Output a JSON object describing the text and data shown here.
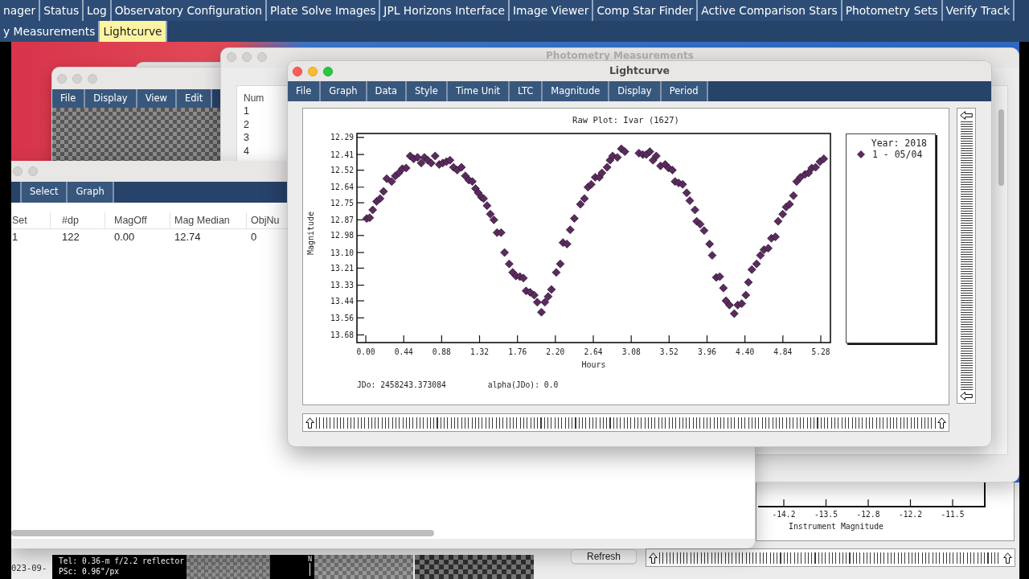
{
  "top_tabs": [
    [
      {
        "label": "nager",
        "selected": false
      },
      {
        "label": "Status",
        "selected": false
      },
      {
        "label": "Log",
        "selected": false
      },
      {
        "label": "Observatory Configuration",
        "selected": false
      },
      {
        "label": "Plate Solve Images",
        "selected": false
      },
      {
        "label": "JPL Horizons Interface",
        "selected": false
      },
      {
        "label": "Image Viewer",
        "selected": false
      },
      {
        "label": "Comp Star Finder",
        "selected": false
      },
      {
        "label": "Active Comparison Stars",
        "selected": false
      },
      {
        "label": "Photometry Sets",
        "selected": false
      },
      {
        "label": "Verify Track",
        "selected": false
      }
    ],
    [
      {
        "label": "y Measurements",
        "selected": false
      },
      {
        "label": "Lightcurve",
        "selected": true
      }
    ]
  ],
  "image_strip": {
    "date": "023-09-",
    "info": [
      "Tel: 0.36-m f/2.2 reflector",
      "PSc: 0.96\"/px"
    ],
    "compass": "N"
  },
  "instrument_window": {
    "button": "Refresh",
    "axis": {
      "ticks": [
        "-14.2",
        "-13.5",
        "-12.8",
        "-12.2",
        "-11.5"
      ],
      "label": "Instrument Magnitude"
    }
  },
  "image_window": {
    "active": false,
    "menu": [
      "File",
      "Display",
      "View",
      "Edit"
    ]
  },
  "photometry_window": {
    "active": false,
    "title": "Photometry Measurements",
    "table": {
      "columns": [
        "Num"
      ],
      "rows": [
        [
          "1"
        ],
        [
          "2"
        ],
        [
          "3"
        ],
        [
          "4"
        ]
      ]
    }
  },
  "sets_window": {
    "active": false,
    "menu": [
      "Select",
      "Graph"
    ],
    "table": {
      "columns": [
        "Set",
        "#dp",
        "MagOff",
        "Mag Median",
        "ObjNu"
      ],
      "rows": [
        [
          "1",
          "122",
          "0.00",
          "12.74",
          "0"
        ]
      ]
    }
  },
  "lightcurve_window": {
    "active": true,
    "title": "Lightcurve",
    "menu": [
      "File",
      "Graph",
      "Data",
      "Style",
      "Time Unit",
      "LTC",
      "Magnitude",
      "Display",
      "Period"
    ],
    "plot": {
      "legend_title": "Year: 2018",
      "jdo": "JDo: 2458243.373084",
      "alpha": "alpha(JDo): 0.0",
      "chart_data": {
        "type": "scatter",
        "title": "Raw Plot: Ivar (1627)",
        "xlabel": "Hours",
        "ylabel": "Magnitude",
        "x": [
          0.01,
          0.045,
          0.08,
          0.125,
          0.165,
          0.206,
          0.243,
          0.3,
          0.343,
          0.384,
          0.424,
          0.468,
          0.515,
          0.555,
          0.6,
          0.643,
          0.68,
          0.718,
          0.758,
          0.805,
          0.852,
          0.893,
          0.936,
          0.977,
          1.018,
          1.061,
          1.11,
          1.155,
          1.196,
          1.236,
          1.273,
          1.305,
          1.342,
          1.367,
          1.407,
          1.445,
          1.486,
          1.523,
          1.57,
          1.61,
          1.664,
          1.704,
          1.742,
          1.788,
          1.829,
          1.86,
          1.907,
          1.954,
          1.99,
          2.038,
          2.078,
          2.116,
          2.154,
          2.21,
          2.257,
          2.288,
          2.335,
          2.372,
          2.42,
          2.49,
          2.537,
          2.578,
          2.616,
          2.662,
          2.71,
          2.74,
          2.8,
          2.834,
          2.865,
          2.92,
          2.965,
          3.006,
          3.17,
          3.215,
          3.256,
          3.296,
          3.333,
          3.371,
          3.42,
          3.474,
          3.514,
          3.558,
          3.589,
          3.63,
          3.677,
          3.724,
          3.76,
          3.82,
          3.84,
          3.88,
          3.926,
          3.99,
          4.02,
          4.067,
          4.108,
          4.15,
          4.18,
          4.22,
          4.276,
          4.316,
          4.363,
          4.41,
          4.44,
          4.48,
          4.535,
          4.58,
          4.62,
          4.67,
          4.707,
          4.754,
          4.785,
          4.838,
          4.878,
          4.918,
          4.963,
          5.0,
          5.044,
          5.097,
          5.138,
          5.175,
          5.22,
          5.27,
          5.315
        ],
        "series": [
          {
            "name": "1 - 05/04",
            "color": "#5b2b5e",
            "values": [
              12.86,
              12.855,
              12.8,
              12.74,
              12.72,
              12.67,
              12.58,
              12.6,
              12.56,
              12.54,
              12.51,
              12.505,
              12.42,
              12.44,
              12.43,
              12.47,
              12.43,
              12.45,
              12.47,
              12.42,
              12.48,
              12.47,
              12.46,
              12.45,
              12.5,
              12.52,
              12.5,
              12.56,
              12.59,
              12.6,
              12.65,
              12.68,
              12.71,
              12.72,
              12.77,
              12.83,
              12.87,
              12.96,
              12.96,
              13.1,
              13.18,
              13.24,
              13.265,
              13.27,
              13.28,
              13.37,
              13.38,
              13.4,
              13.45,
              13.52,
              13.45,
              13.41,
              13.36,
              13.24,
              13.18,
              13.03,
              13.04,
              12.94,
              12.86,
              12.76,
              12.72,
              12.64,
              12.62,
              12.57,
              12.57,
              12.54,
              12.5,
              12.45,
              12.42,
              12.43,
              12.37,
              12.39,
              12.4,
              12.41,
              12.41,
              12.39,
              12.45,
              12.42,
              12.49,
              12.48,
              12.505,
              12.52,
              12.6,
              12.61,
              12.62,
              12.68,
              12.735,
              12.8,
              12.88,
              12.9,
              12.945,
              13.04,
              13.12,
              13.275,
              13.27,
              13.35,
              13.44,
              13.47,
              13.53,
              13.47,
              13.46,
              13.4,
              13.31,
              13.22,
              13.18,
              13.12,
              13.08,
              13.07,
              13.0,
              12.99,
              12.88,
              12.83,
              12.78,
              12.76,
              12.7,
              12.6,
              12.57,
              12.55,
              12.54,
              12.505,
              12.5,
              12.46,
              12.44
            ]
          }
        ],
        "xlim": [
          -0.103,
          5.392
        ],
        "ylim": [
          13.734,
          12.262
        ],
        "xticks": [
          {
            "value": 0,
            "label": "0.00"
          },
          {
            "value": 0.44,
            "label": "0.44"
          },
          {
            "value": 0.88,
            "label": "0.88"
          },
          {
            "value": 1.32,
            "label": "1.32"
          },
          {
            "value": 1.76,
            "label": "1.76"
          },
          {
            "value": 2.2,
            "label": "2.20"
          },
          {
            "value": 2.64,
            "label": "2.64"
          },
          {
            "value": 3.08,
            "label": "3.08"
          },
          {
            "value": 3.52,
            "label": "3.52"
          },
          {
            "value": 3.96,
            "label": "3.96"
          },
          {
            "value": 4.4,
            "label": "4.40"
          },
          {
            "value": 4.84,
            "label": "4.84"
          },
          {
            "value": 5.28,
            "label": "5.28"
          }
        ],
        "yticks": [
          {
            "value": 12.29,
            "label": "12.29"
          },
          {
            "value": 12.41,
            "label": "12.41"
          },
          {
            "value": 12.52,
            "label": "12.52"
          },
          {
            "value": 12.64,
            "label": "12.64"
          },
          {
            "value": 12.75,
            "label": "12.75"
          },
          {
            "value": 12.87,
            "label": "12.87"
          },
          {
            "value": 12.98,
            "label": "12.98"
          },
          {
            "value": 13.1,
            "label": "13.10"
          },
          {
            "value": 13.21,
            "label": "13.21"
          },
          {
            "value": 13.33,
            "label": "13.33"
          },
          {
            "value": 13.44,
            "label": "13.44"
          },
          {
            "value": 13.56,
            "label": "13.56"
          },
          {
            "value": 13.68,
            "label": "13.68"
          }
        ]
      }
    }
  }
}
